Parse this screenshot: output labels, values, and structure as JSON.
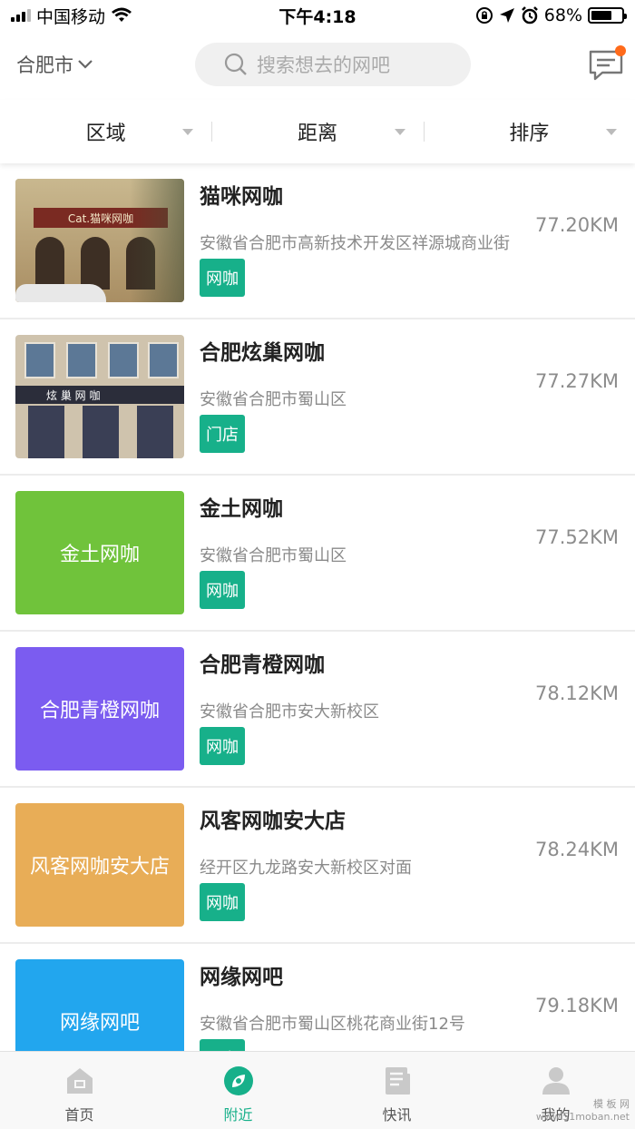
{
  "status_bar": {
    "carrier": "中国移动",
    "time": "下午4:18",
    "battery": "68%",
    "battery_level": 0.68
  },
  "header": {
    "city": "合肥市",
    "search_placeholder": "搜索想去的网吧",
    "message_icon": "chat-bubble-icon",
    "has_unread": true
  },
  "filters": [
    {
      "label": "区域"
    },
    {
      "label": "距离"
    },
    {
      "label": "排序"
    }
  ],
  "cafes": [
    {
      "name": "",
      "address": "",
      "tag": "",
      "distance": "",
      "thumb_text": "",
      "thumb_color": "#7b5cf0"
    },
    {
      "name": "猫咪网咖",
      "address": "安徽省合肥市高新技术开发区祥源城商业街",
      "tag": "网咖",
      "distance": "77.20KM",
      "thumb_text": "",
      "photo_sign": "Cat.猫咪网咖"
    },
    {
      "name": "合肥炫巢网咖",
      "address": "安徽省合肥市蜀山区",
      "tag": "门店",
      "distance": "77.27KM",
      "thumb_text": "",
      "photo_sign": "炫 巢 网 咖"
    },
    {
      "name": "金土网咖",
      "address": "安徽省合肥市蜀山区",
      "tag": "网咖",
      "distance": "77.52KM",
      "thumb_text": "金土网咖",
      "thumb_color": "#70c33b"
    },
    {
      "name": "合肥青橙网咖",
      "address": "安徽省合肥市安大新校区",
      "tag": "网咖",
      "distance": "78.12KM",
      "thumb_text": "合肥青橙网咖",
      "thumb_color": "#7b5cf0"
    },
    {
      "name": "风客网咖安大店",
      "address": "经开区九龙路安大新校区对面",
      "tag": "网咖",
      "distance": "78.24KM",
      "thumb_text": "风客网咖安大店",
      "thumb_color": "#e8ad57"
    },
    {
      "name": "网缘网吧",
      "address": "安徽省合肥市蜀山区桃花商业街12号",
      "tag": "网咖",
      "distance": "79.18KM",
      "thumb_text": "网缘网吧",
      "thumb_color": "#22a6ee"
    }
  ],
  "tabs": [
    {
      "label": "首页",
      "icon": "home-icon",
      "active": false
    },
    {
      "label": "附近",
      "icon": "compass-icon",
      "active": true
    },
    {
      "label": "快讯",
      "icon": "news-icon",
      "active": false
    },
    {
      "label": "我的",
      "icon": "user-icon",
      "active": false
    }
  ],
  "colors": {
    "accent": "#17b08a",
    "notification_dot": "#ff6a1a"
  },
  "watermark": {
    "line1": "模 板 网",
    "line2": "www.51moban.net"
  }
}
